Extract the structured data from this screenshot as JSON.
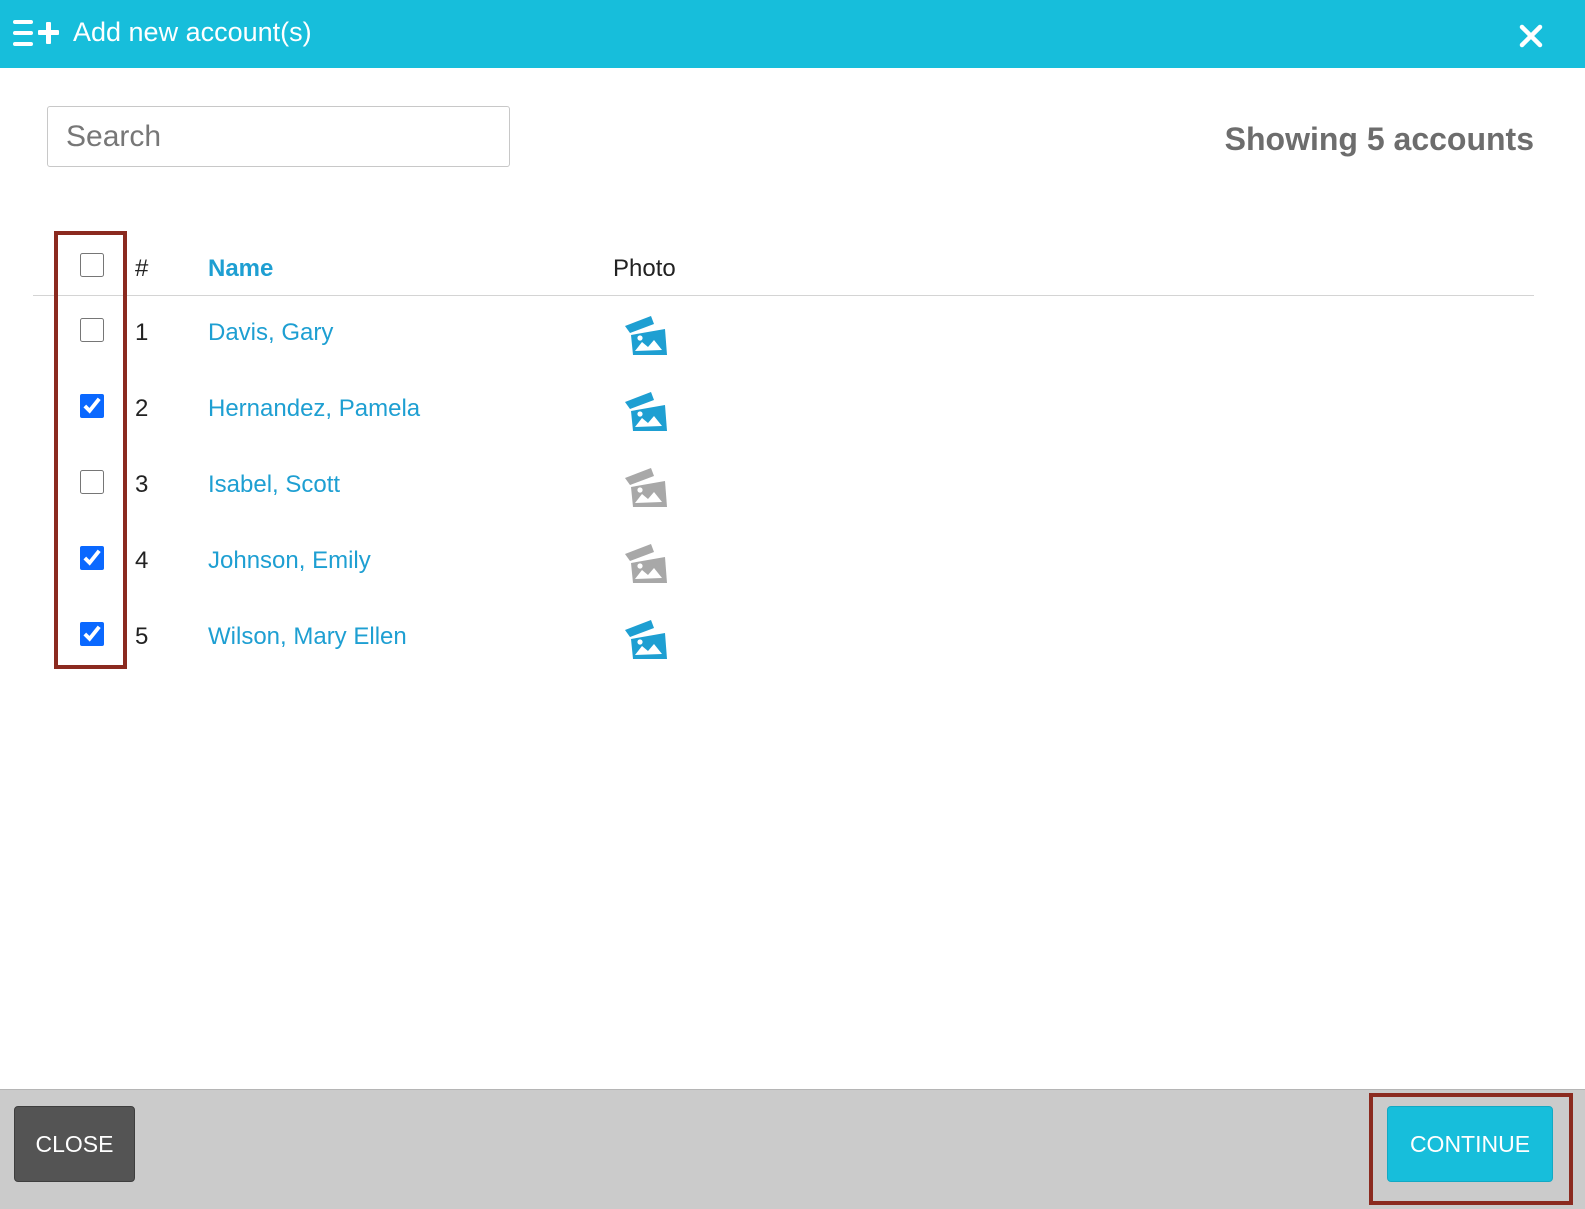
{
  "header": {
    "title": "Add new account(s)",
    "icon": "list-add-icon",
    "close_icon": "close-icon",
    "background_color": "#17bedb"
  },
  "search": {
    "placeholder": "Search",
    "value": ""
  },
  "summary": {
    "showing_text": "Showing 5 accounts"
  },
  "table": {
    "select_all_checked": false,
    "columns": {
      "number": "#",
      "name": "Name",
      "photo": "Photo"
    },
    "rows": [
      {
        "number": "1",
        "name": "Davis, Gary",
        "checked": false,
        "photo_status": "has-photo"
      },
      {
        "number": "2",
        "name": "Hernandez, Pamela",
        "checked": true,
        "photo_status": "has-photo"
      },
      {
        "number": "3",
        "name": "Isabel, Scott",
        "checked": false,
        "photo_status": "no-photo"
      },
      {
        "number": "4",
        "name": "Johnson, Emily",
        "checked": true,
        "photo_status": "no-photo"
      },
      {
        "number": "5",
        "name": "Wilson, Mary Ellen",
        "checked": true,
        "photo_status": "has-photo"
      }
    ]
  },
  "footer": {
    "close_label": "CLOSE",
    "continue_label": "CONTINUE"
  },
  "colors": {
    "accent": "#17bedb",
    "link": "#1e9fd2",
    "photo_active": "#1e9fd2",
    "photo_inactive": "#a8a8a8",
    "highlight": "#8b2a1f"
  }
}
